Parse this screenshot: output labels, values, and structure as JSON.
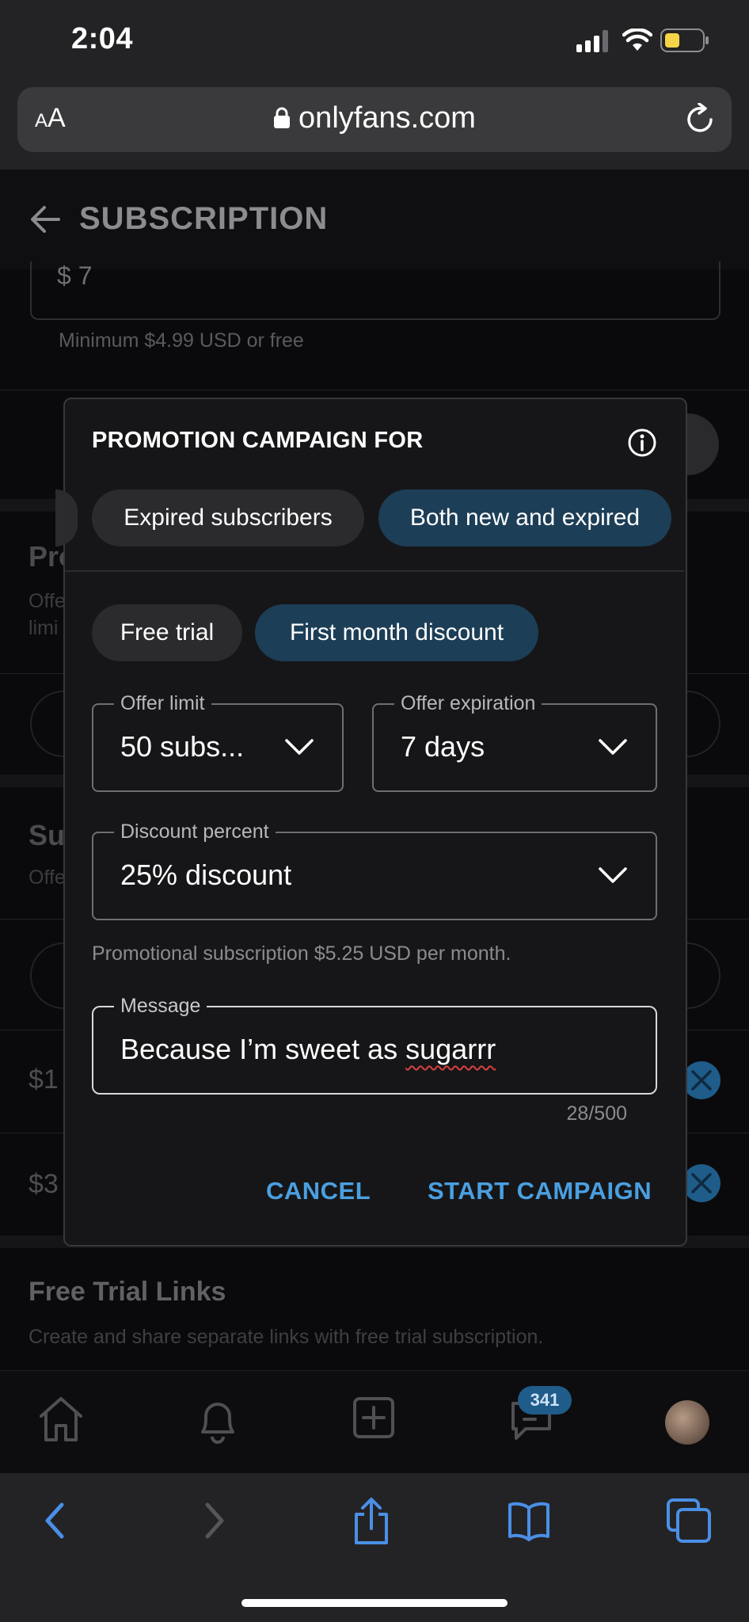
{
  "status_bar": {
    "time": "2:04"
  },
  "browser": {
    "text_size_label": "AA",
    "url": "onlyfans.com"
  },
  "header": {
    "title": "SUBSCRIPTION"
  },
  "background": {
    "price_value": "$ 7",
    "price_hint": "Minimum $4.99 USD or free",
    "section1_title": "Pro",
    "section1_text_line1": "Offe",
    "section1_text_line2": "limi",
    "section2_title": "Su",
    "section2_text": "Offe",
    "row1_price": "$1",
    "row2_price": "$3",
    "free_trial_title": "Free Trial Links",
    "free_trial_text": "Create and share separate links with free trial subscription."
  },
  "tab_bar": {
    "items": [
      "home-icon",
      "bell-icon",
      "add-post-icon",
      "messages-icon",
      "avatar"
    ],
    "messages_badge": "341"
  },
  "modal": {
    "title": "PROMOTION CAMPAIGN FOR",
    "audience_options": [
      {
        "label": "Expired subscribers",
        "selected": false
      },
      {
        "label": "Both new and expired",
        "selected": true
      }
    ],
    "type_options": [
      {
        "label": "Free trial",
        "selected": false
      },
      {
        "label": "First month discount",
        "selected": true
      }
    ],
    "offer_limit": {
      "label": "Offer limit",
      "value": "50 subs..."
    },
    "offer_expiration": {
      "label": "Offer expiration",
      "value": "7 days"
    },
    "discount_percent": {
      "label": "Discount percent",
      "value": "25% discount"
    },
    "promo_note": "Promotional subscription $5.25 USD per month.",
    "message": {
      "label": "Message",
      "value_prefix": "Because I’m sweet as ",
      "value_misspelled": "sugarrr",
      "counter": "28/500"
    },
    "cancel_label": "CANCEL",
    "start_label": "START CAMPAIGN"
  },
  "colors": {
    "accent": "#4a9fe0",
    "chip_selected": "#1d3e57",
    "badge": "#1f5c8a"
  }
}
